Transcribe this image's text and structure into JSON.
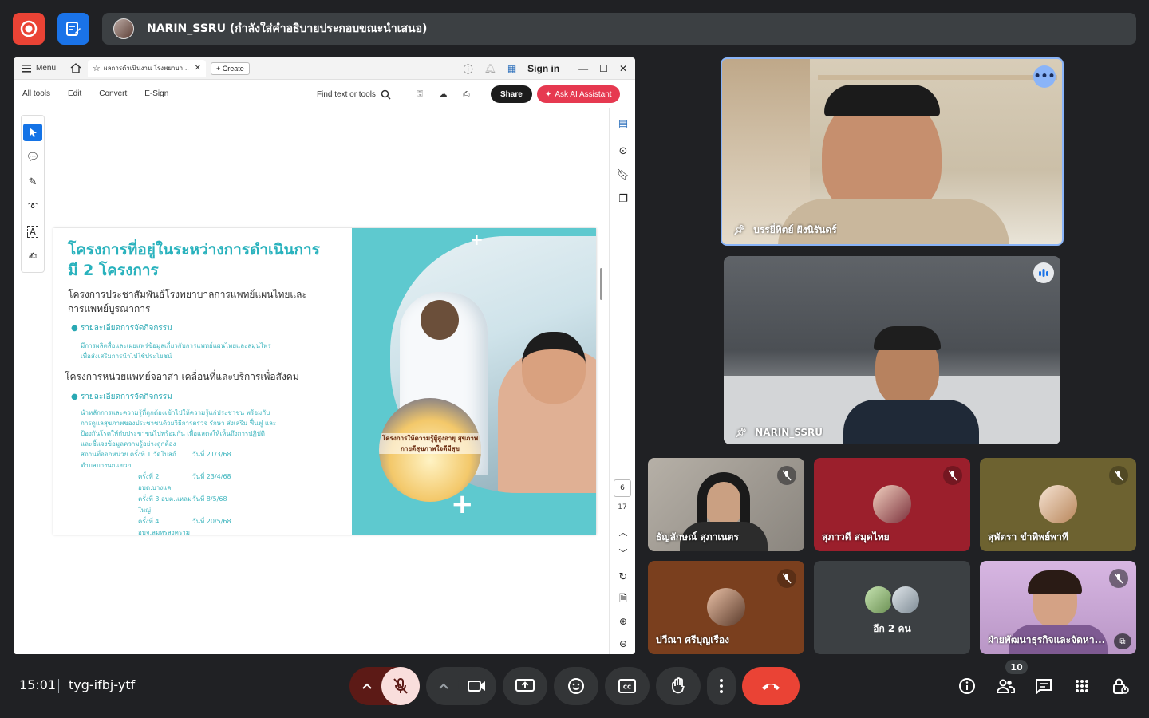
{
  "banner": {
    "presenter_text": "NARIN_SSRU (กำลังใส่คำอธิบายประกอบขณะนำเสนอ)"
  },
  "acrobat": {
    "menu_label": "Menu",
    "tab_title": "ผลการดำเนินงาน โรงพยาบาล...",
    "create_label": "Create",
    "sign_in_label": "Sign in",
    "tools": [
      "All tools",
      "Edit",
      "Convert",
      "E-Sign"
    ],
    "find_placeholder": "Find text or tools",
    "share_label": "Share",
    "ai_label": "Ask AI Assistant",
    "page_current": "6",
    "page_total": "17"
  },
  "slide": {
    "title_line1": "โครงการที่อยู่ในระหว่างการดำเนินการ",
    "title_line2": "มี 2 โครงการ",
    "project1_line1": "โครงการประชาสัมพันธ์โรงพยาบาลการแพทย์แผนไทยและ",
    "project1_line2": "การแพทย์บูรณาการ",
    "bullet_label": "รายละเอียดการจัดกิจกรรม",
    "project1_detail_line1": "มีการผลิตสื่อและเผยแพร่ข้อมูลเกี่ยวกับการแพทย์แผนไทยและสมุนไพร",
    "project1_detail_line2": "เพื่อส่งเสริมการนำไปใช้ประโยชน์",
    "project2": "โครงการหน่วยแพทย์จอาสา เคลื่อนที่และบริการเพื่อสังคม",
    "project2_detail_line1": "นำหลักการและความรู้ที่ถูกต้องเข้าไปให้ความรู้แก่ประชาชน พร้อมกับ",
    "project2_detail_line2": "การดูแลสุขภาพของประชาชนด้วยวิธีการตรวจ รักษา ส่งเสริม ฟื้นฟู และ",
    "project2_detail_line3": "ป้องกันโรคให้กับประชาชนไปพร้อมกัน เพื่อแสดงให้เห็นถึงการปฏิบัติ",
    "project2_detail_line4": "และชี้แจงข้อมูลความรู้อย่างถูกต้อง",
    "schedule": [
      {
        "place": "สถานที่ออกหน่วย ครั้งที่ 1 วัดโบสถ์ ตำบลบางนกแขวก",
        "date": "วันที่ 21/3/68"
      },
      {
        "place": "ครั้งที่ 2 อบต.บางแค",
        "date": "วันที่ 23/4/68"
      },
      {
        "place": "ครั้งที่ 3 อบต.แหลมใหญ่",
        "date": "วันที่ 8/5/68"
      },
      {
        "place": "ครั้งที่ 4 อบจ.สมุทรสงคราม",
        "date": "วันที่ 20/5/68"
      }
    ],
    "poster_text": "โครงการให้ความรู้ผู้สูงอายุ สุขภาพกายดีสุขภาพใจดีมีสุข"
  },
  "participants": [
    {
      "name": "บรรยี่ทิตย์ ฝังนิรันดร์",
      "pinned": true
    },
    {
      "name": "NARIN_SSRU",
      "pinned": true
    },
    {
      "name": "ธัญลักษณ์ สุภาเนตร",
      "muted": true
    },
    {
      "name": "สุภาวดี สมุดไทย",
      "muted": true
    },
    {
      "name": "สุพัตรา ขำทิพย์พาที",
      "muted": true
    },
    {
      "name": "ปวีณา ศรีบุญเรือง",
      "muted": true
    },
    {
      "name": "อีก 2 คน"
    },
    {
      "name": "ฝ่ายพัฒนาธุรกิจและจัดหา...",
      "muted": true
    }
  ],
  "bottom": {
    "time": "15:01",
    "meeting_code": "tyg-ifbj-ytf",
    "people_count": "10"
  },
  "colors": {
    "leave": "#ea4335",
    "record": "#ea4335",
    "notes": "#1a73e8",
    "slide_accent": "#29b2bd"
  }
}
